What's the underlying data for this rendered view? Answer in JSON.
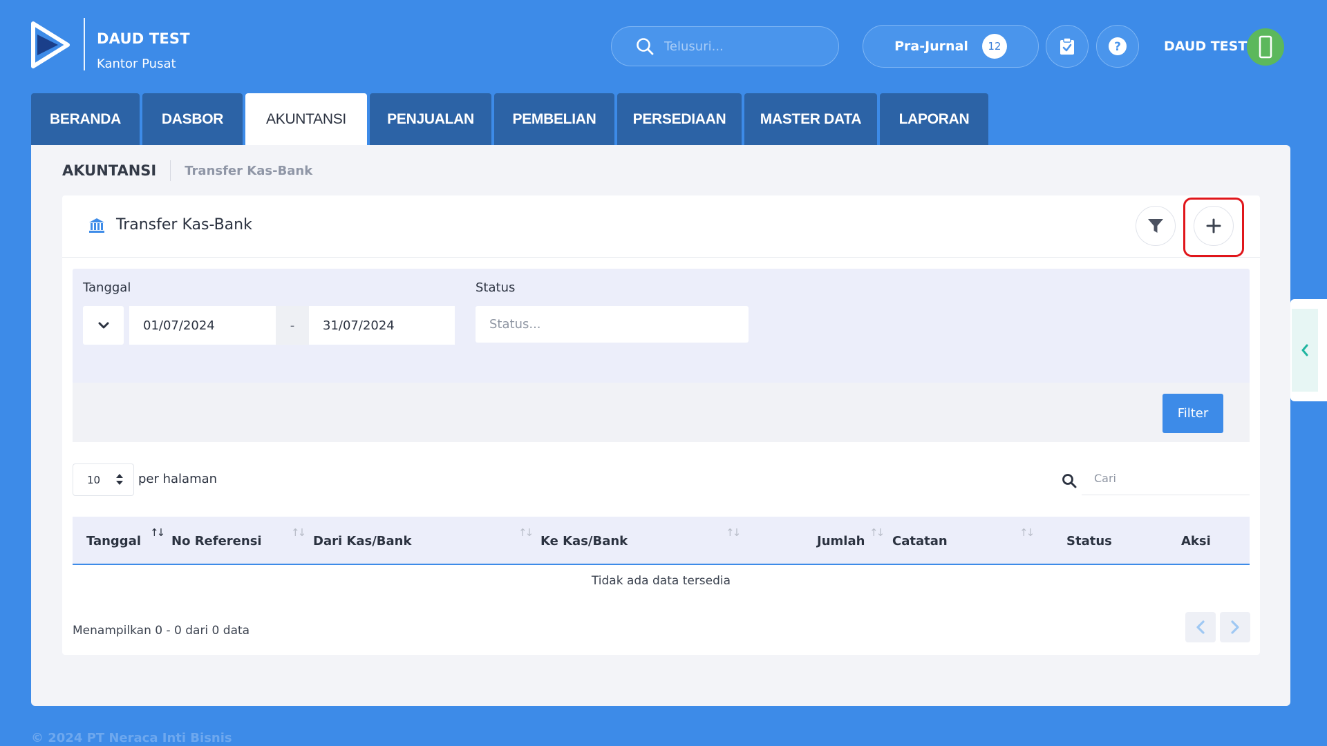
{
  "header": {
    "company_name": "DAUD TEST",
    "company_branch": "Kantor Pusat",
    "search_placeholder": "Telusuri...",
    "prajurnal_label": "Pra-Jurnal",
    "prajurnal_count": "12",
    "user_name": "DAUD TEST"
  },
  "nav": {
    "tabs": [
      {
        "label": "BERANDA"
      },
      {
        "label": "DASBOR"
      },
      {
        "label": "AKUNTANSI",
        "active": true
      },
      {
        "label": "PENJUALAN"
      },
      {
        "label": "PEMBELIAN"
      },
      {
        "label": "PERSEDIAAN"
      },
      {
        "label": "MASTER DATA"
      },
      {
        "label": "LAPORAN"
      }
    ]
  },
  "breadcrumb": {
    "root": "AKUNTANSI",
    "current": "Transfer Kas-Bank"
  },
  "panel": {
    "title": "Transfer Kas-Bank",
    "icon": "bank-icon"
  },
  "filters": {
    "date_label": "Tanggal",
    "date_from": "01/07/2024",
    "date_separator": "-",
    "date_to": "31/07/2024",
    "status_label": "Status",
    "status_placeholder": "Status...",
    "filter_button": "Filter"
  },
  "table": {
    "per_page": "10",
    "per_page_label": "per halaman",
    "search_placeholder": "Cari",
    "columns": [
      "Tanggal",
      "No Referensi",
      "Dari Kas/Bank",
      "Ke Kas/Bank",
      "Jumlah",
      "Catatan",
      "Status",
      "Aksi"
    ],
    "empty_text": "Tidak ada data tersedia",
    "info_text": "Menampilkan 0 - 0 dari 0 data"
  },
  "footer": {
    "copyright": "© 2024 PT Neraca Inti Bisnis"
  },
  "colors": {
    "primary": "#3d8be8",
    "tab_bg": "#2c63a6",
    "highlight": "#e0161b",
    "avatar": "#5cb85c",
    "accent_teal": "#1fb5a0"
  }
}
